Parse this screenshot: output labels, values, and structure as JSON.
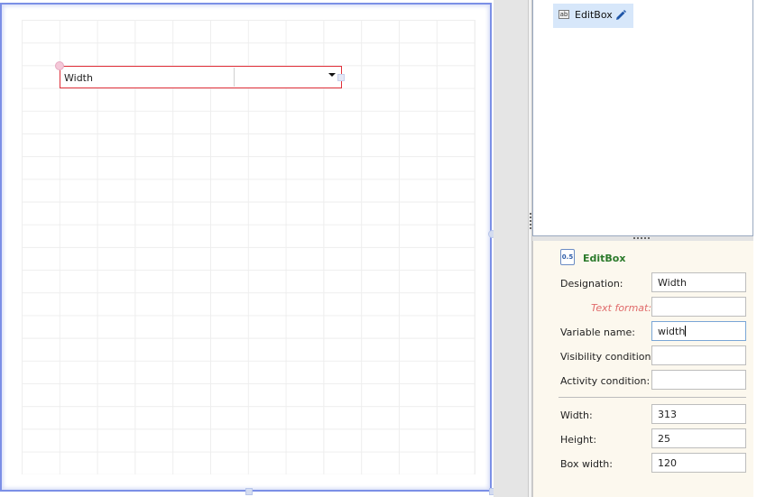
{
  "canvas": {
    "widget": {
      "label": "Width",
      "box_value": ""
    }
  },
  "tree": {
    "item_label": "EditBox",
    "item_icon": "editbox-icon",
    "edit_icon": "pencil-icon"
  },
  "properties": {
    "title": "EditBox",
    "title_icon_text": "0.5",
    "fields": {
      "designation": {
        "label": "Designation:",
        "value": "Width"
      },
      "text_format": {
        "label": "Text format:",
        "value": ""
      },
      "variable_name": {
        "label": "Variable name:",
        "value": "width"
      },
      "visibility_condition": {
        "label": "Visibility condition:",
        "value": ""
      },
      "activity_condition": {
        "label": "Activity condition:",
        "value": ""
      },
      "width": {
        "label": "Width:",
        "value": "313"
      },
      "height": {
        "label": "Height:",
        "value": "25"
      },
      "box_width": {
        "label": "Box width:",
        "value": "120"
      }
    }
  },
  "colors": {
    "selection_border": "#e0303a",
    "canvas_border": "#7b8fe6",
    "title_green": "#2b7a2b",
    "text_format_red": "#e06a6a",
    "tree_highlight": "#d7e7fa",
    "props_background": "#fcf8ee"
  }
}
